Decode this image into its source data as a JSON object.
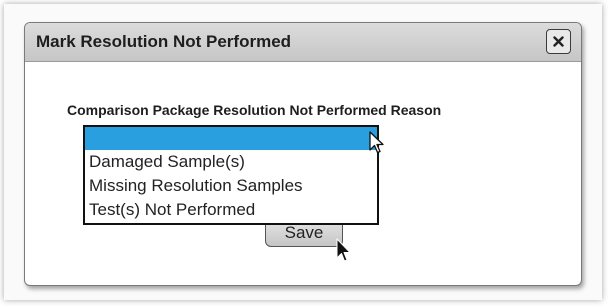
{
  "dialog": {
    "title": "Mark Resolution Not Performed",
    "close_icon": "close-icon"
  },
  "form": {
    "label": "Comparison Package Resolution Not Performed Reason",
    "dropdown": {
      "selected": "",
      "options": [
        "Damaged Sample(s)",
        "Missing Resolution Samples",
        "Test(s) Not Performed"
      ]
    },
    "save_label": "Save"
  },
  "colors": {
    "highlight": "#2a9fe0",
    "titlebar": "#cfcfcf"
  },
  "icons": [
    "close-icon",
    "mouse-pointer-icon"
  ]
}
